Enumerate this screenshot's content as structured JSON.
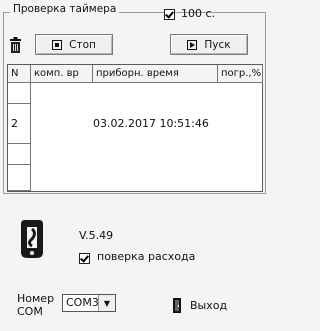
{
  "timer_group": {
    "title": "Проверка таймера"
  },
  "timer_checkbox": {
    "label": "100 с.",
    "checked": true
  },
  "toolbar": {
    "stop_label": "Стоп",
    "start_label": "Пуск"
  },
  "table": {
    "columns": [
      "N",
      "комп. вр",
      "приборн. время",
      "погр.,%"
    ],
    "rows": [
      [
        "",
        "",
        "",
        ""
      ],
      [
        "2",
        "",
        "03.02.2017 10:51:46",
        ""
      ],
      [
        "",
        "",
        "",
        ""
      ],
      [
        "",
        "",
        "",
        ""
      ]
    ]
  },
  "app": {
    "version": "V.5.49"
  },
  "flow_check": {
    "label": "поверка расхода",
    "checked": true
  },
  "com_port": {
    "label_line1": "Номер",
    "label_line2": "COM",
    "value": "COM3"
  },
  "exit_button": {
    "label": "Выход"
  }
}
